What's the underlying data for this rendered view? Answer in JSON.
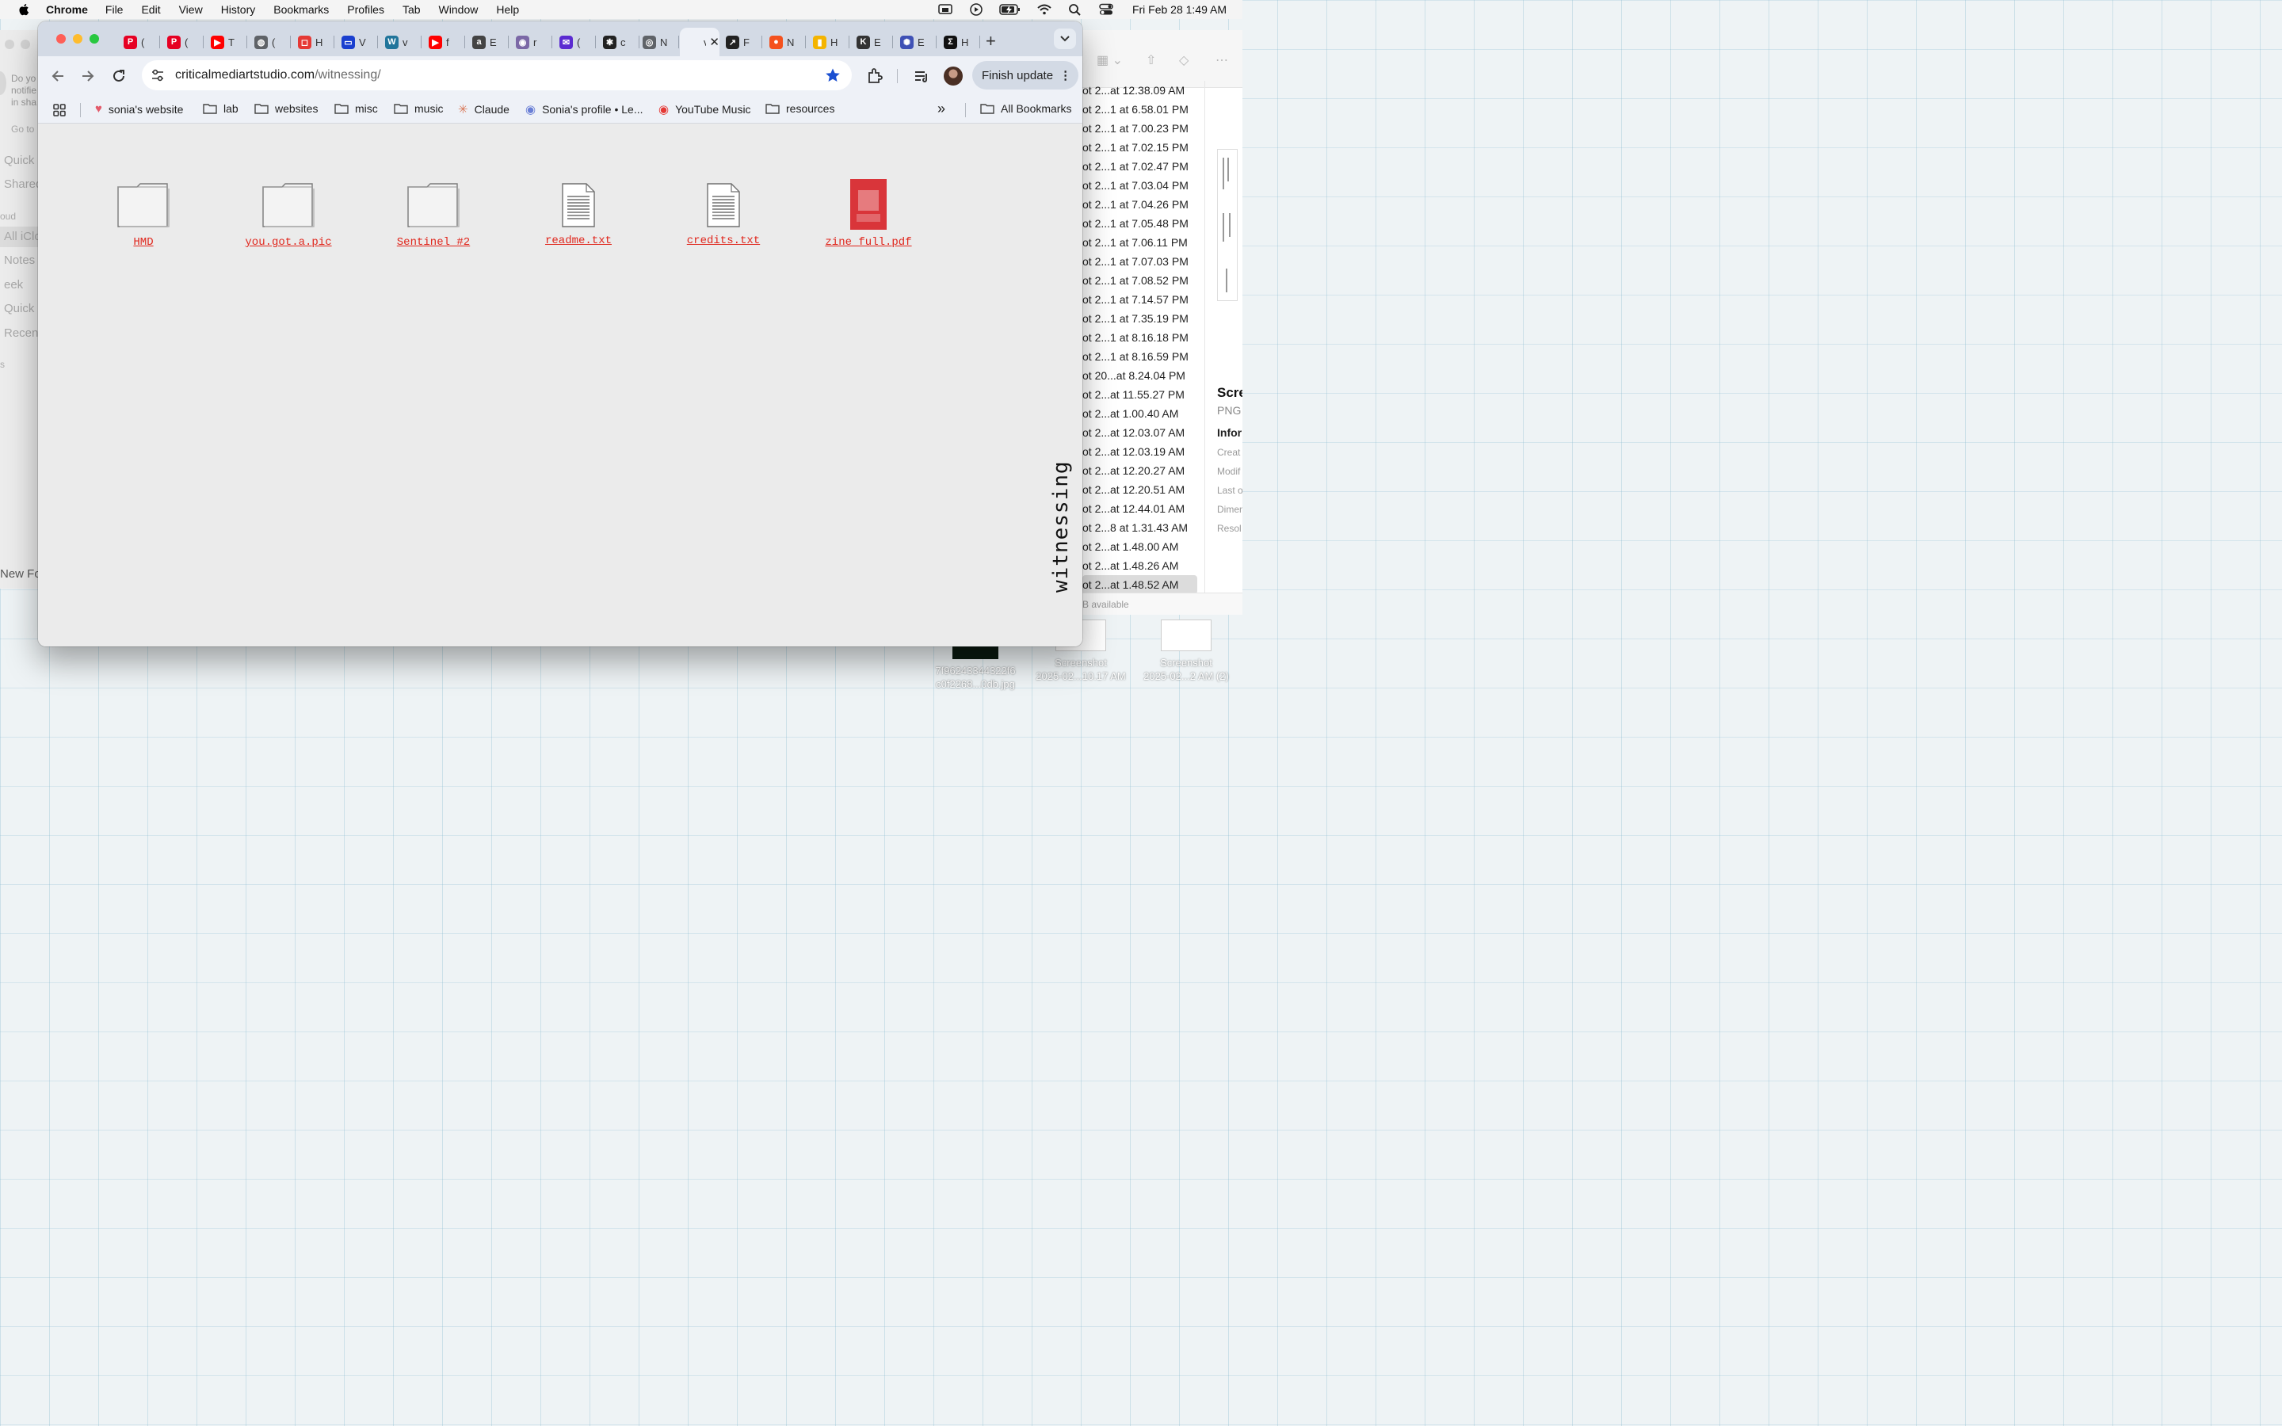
{
  "menubar": {
    "app": "Chrome",
    "items": [
      "File",
      "Edit",
      "View",
      "History",
      "Bookmarks",
      "Profiles",
      "Tab",
      "Window",
      "Help"
    ],
    "clock": "Fri Feb 28  1:49 AM",
    "status_icons": [
      "screen-mirror-icon",
      "play-icon",
      "battery-charging-icon",
      "wifi-icon",
      "search-icon",
      "control-center-icon"
    ]
  },
  "finder_left": {
    "notification": [
      "Do yo",
      "notifie",
      "in sha"
    ],
    "goto": "Go to",
    "items": [
      "Quick",
      "Shared",
      "oud",
      "All iClo",
      "Notes",
      "eek",
      "Quick",
      "Recent",
      "s"
    ],
    "new_folder": "New Fol"
  },
  "finder_right": {
    "files": [
      "ot 2...at 12.38.09 AM",
      "ot 2...1 at 6.58.01 PM",
      "ot 2...1 at 7.00.23 PM",
      "ot 2...1 at 7.02.15 PM",
      "ot 2...1 at 7.02.47 PM",
      "ot 2...1 at 7.03.04 PM",
      "ot 2...1 at 7.04.26 PM",
      "ot 2...1 at 7.05.48 PM",
      "ot 2...1 at 7.06.11 PM",
      "ot 2...1 at 7.07.03 PM",
      "ot 2...1 at 7.08.52 PM",
      "ot 2...1 at 7.14.57 PM",
      "ot 2...1 at 7.35.19 PM",
      "ot 2...1 at 8.16.18 PM",
      "ot 2...1 at 8.16.59 PM",
      "ot 20...at 8.24.04 PM",
      "ot 2...at 11.55.27 PM",
      "ot 2...at 1.00.40 AM",
      "ot 2...at 12.03.07 AM",
      "ot 2...at 12.03.19 AM",
      "ot 2...at 12.20.27 AM",
      "ot 2...at 12.20.51 AM",
      "ot 2...at 12.44.01 AM",
      "ot 2...8 at 1.31.43 AM",
      "ot 2...at 1.48.00 AM",
      "ot 2...at 1.48.26 AM",
      "ot 2...at 1.48.52 AM"
    ],
    "info_title": "Scre",
    "info_type": "PNG",
    "info_header": "Infor",
    "info_labels": [
      "Creat",
      "Modif",
      "Last o",
      "Dimen",
      "Resol"
    ],
    "status": "B available"
  },
  "desktop_icons": [
    {
      "line1": "7f96243344322f6",
      "line2": "c0f2268...0db.jpg"
    },
    {
      "line1": "Screenshot",
      "line2": "2025-02...10.17 AM"
    },
    {
      "line1": "Screenshot",
      "line2": "2025-02...2 AM (2)"
    }
  ],
  "tabs": [
    {
      "icon": "pinterest-icon",
      "color": "#e60023",
      "glyph": "P",
      "title": "("
    },
    {
      "icon": "pinterest-icon",
      "color": "#e60023",
      "glyph": "P",
      "title": "("
    },
    {
      "icon": "youtube-icon",
      "color": "#ff0000",
      "glyph": "▶",
      "title": "T"
    },
    {
      "icon": "globe-icon",
      "color": "#5f6368",
      "glyph": "◍",
      "title": "("
    },
    {
      "icon": "red-square-icon",
      "color": "#e53935",
      "glyph": "◻",
      "title": "H"
    },
    {
      "icon": "folder-tab-icon",
      "color": "#1a3fcf",
      "glyph": "▭",
      "title": "V"
    },
    {
      "icon": "wordpress-icon",
      "color": "#21759b",
      "glyph": "W",
      "title": "v"
    },
    {
      "icon": "youtube-icon",
      "color": "#ff0000",
      "glyph": "▶",
      "title": "f"
    },
    {
      "icon": "a-circle-icon",
      "color": "#444444",
      "glyph": "a",
      "title": "E"
    },
    {
      "icon": "purple-app-icon",
      "color": "#7b68a6",
      "glyph": "◉",
      "title": "r"
    },
    {
      "icon": "mail-icon",
      "color": "#5b2bd1",
      "glyph": "✉",
      "title": "("
    },
    {
      "icon": "asterisk-icon",
      "color": "#222222",
      "glyph": "✱",
      "title": "c"
    },
    {
      "icon": "chrome-icon",
      "color": "#5f6368",
      "glyph": "◎",
      "title": "N"
    },
    {
      "icon": "page-icon",
      "color": "#5f6368",
      "glyph": "",
      "title": "v"
    },
    {
      "icon": "pen-icon",
      "color": "#222222",
      "glyph": "↗",
      "title": "F"
    },
    {
      "icon": "orange-dot-icon",
      "color": "#f4511e",
      "glyph": "●",
      "title": "N"
    },
    {
      "icon": "rainbow-icon",
      "color": "#f4b400",
      "glyph": "▮",
      "title": "H"
    },
    {
      "icon": "text-logo-icon",
      "color": "#333333",
      "glyph": "K",
      "title": "E"
    },
    {
      "icon": "planet-icon",
      "color": "#3f51b5",
      "glyph": "✺",
      "title": "E"
    },
    {
      "icon": "sigma-icon",
      "color": "#111111",
      "glyph": "Σ",
      "title": "H"
    }
  ],
  "toolbar": {
    "url_host": "criticalmediartstudio.com",
    "url_path": "/witnessing/",
    "finish_update": "Finish update"
  },
  "bookmarks": [
    {
      "icon": "heart-icon",
      "label": "sonia's website"
    },
    {
      "icon": "folder-icon",
      "label": "lab"
    },
    {
      "icon": "folder-icon",
      "label": "websites"
    },
    {
      "icon": "folder-icon",
      "label": "misc"
    },
    {
      "icon": "folder-icon",
      "label": "music"
    },
    {
      "icon": "claude-icon",
      "label": "Claude"
    },
    {
      "icon": "profile-dots-icon",
      "label": "Sonia's profile • Le..."
    },
    {
      "icon": "youtube-music-icon",
      "label": "YouTube Music"
    },
    {
      "icon": "folder-icon",
      "label": "resources"
    }
  ],
  "all_bookmarks": "All Bookmarks",
  "page": {
    "items": [
      {
        "type": "folder",
        "label": "HMD"
      },
      {
        "type": "folder",
        "label": "you.got.a.pic"
      },
      {
        "type": "folder",
        "label": "Sentinel #2"
      },
      {
        "type": "text",
        "label": "readme.txt"
      },
      {
        "type": "text",
        "label": "credits.txt"
      },
      {
        "type": "pdf",
        "label": "zine_full.pdf"
      }
    ],
    "vertical_title": "witnessing"
  },
  "colors": {
    "link": "#e0261c",
    "tabstrip": "#d3dae5",
    "toolbar": "#eef1f7",
    "page_bg": "#ebebeb"
  }
}
